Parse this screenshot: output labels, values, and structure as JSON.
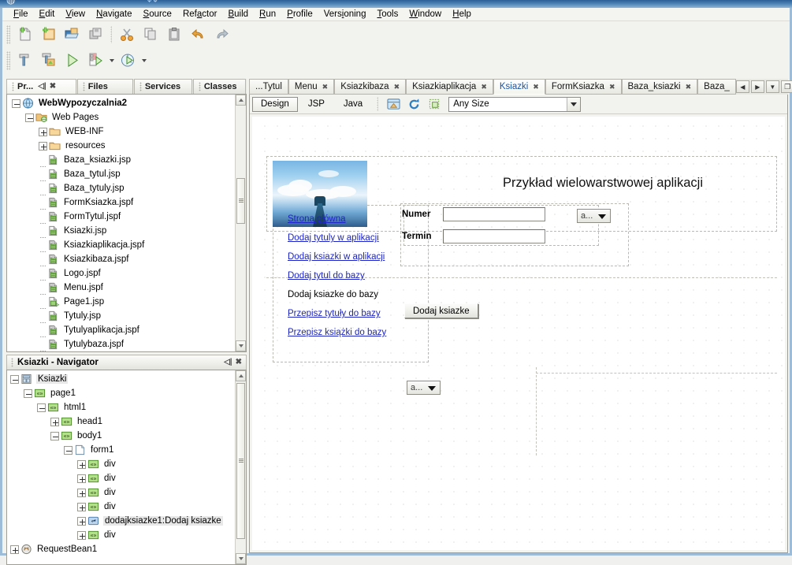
{
  "menubar": {
    "items": [
      {
        "label": "File",
        "mn": "F"
      },
      {
        "label": "Edit",
        "mn": "E"
      },
      {
        "label": "View",
        "mn": "V"
      },
      {
        "label": "Navigate",
        "mn": "N"
      },
      {
        "label": "Source",
        "mn": "S"
      },
      {
        "label": "Refactor",
        "mn": "a"
      },
      {
        "label": "Build",
        "mn": "B"
      },
      {
        "label": "Run",
        "mn": "R"
      },
      {
        "label": "Profile",
        "mn": "P"
      },
      {
        "label": "Versioning",
        "mn": "i"
      },
      {
        "label": "Tools",
        "mn": "T"
      },
      {
        "label": "Window",
        "mn": "W"
      },
      {
        "label": "Help",
        "mn": "H"
      }
    ]
  },
  "toolbar": {
    "row1": [
      {
        "name": "new-file-icon",
        "title": "New File"
      },
      {
        "name": "new-project-icon",
        "title": "New Project"
      },
      {
        "name": "open-project-icon",
        "title": "Open Project"
      },
      {
        "name": "save-all-icon",
        "title": "Save All"
      },
      {
        "name": "cut-icon",
        "title": "Cut"
      },
      {
        "name": "copy-icon",
        "title": "Copy"
      },
      {
        "name": "paste-icon",
        "title": "Paste"
      },
      {
        "name": "undo-icon",
        "title": "Undo"
      },
      {
        "name": "redo-icon",
        "title": "Redo"
      }
    ],
    "row2": [
      {
        "name": "build-icon",
        "title": "Build Main Project"
      },
      {
        "name": "clean-build-icon",
        "title": "Clean and Build Main Project"
      },
      {
        "name": "run-icon",
        "title": "Run Main Project"
      },
      {
        "name": "debug-icon",
        "title": "Debug Main Project"
      },
      {
        "name": "profile-icon",
        "title": "Profile Main Project"
      }
    ]
  },
  "left": {
    "tabs": [
      {
        "label": "Pr...",
        "active": true
      },
      {
        "label": "Files",
        "active": false
      },
      {
        "label": "Services",
        "active": false
      },
      {
        "label": "Classes",
        "active": false
      }
    ],
    "tab_icons": {
      "minimize": "minimize-icon",
      "close": "close-icon"
    },
    "tree": [
      {
        "label": "WebWypozyczalnia2",
        "depth": 0,
        "kind": "project",
        "handle": "minus",
        "bold": true
      },
      {
        "label": "Web Pages",
        "depth": 1,
        "kind": "webpages",
        "handle": "minus",
        "bold": false
      },
      {
        "label": "WEB-INF",
        "depth": 2,
        "kind": "folder",
        "handle": "plus",
        "bold": false
      },
      {
        "label": "resources",
        "depth": 2,
        "kind": "folder",
        "handle": "plus",
        "bold": false
      },
      {
        "label": "Baza_ksiazki.jsp",
        "depth": 2,
        "kind": "jsp",
        "handle": "none",
        "bold": false
      },
      {
        "label": "Baza_tytul.jsp",
        "depth": 2,
        "kind": "jsp",
        "handle": "none",
        "bold": false
      },
      {
        "label": "Baza_tytuly.jsp",
        "depth": 2,
        "kind": "jsp",
        "handle": "none",
        "bold": false
      },
      {
        "label": "FormKsiazka.jspf",
        "depth": 2,
        "kind": "jspf",
        "handle": "none",
        "bold": false
      },
      {
        "label": "FormTytul.jspf",
        "depth": 2,
        "kind": "jspf",
        "handle": "none",
        "bold": false
      },
      {
        "label": "Ksiazki.jsp",
        "depth": 2,
        "kind": "jsp",
        "handle": "none",
        "bold": false
      },
      {
        "label": "Ksiazkiaplikacja.jspf",
        "depth": 2,
        "kind": "jspf",
        "handle": "none",
        "bold": false
      },
      {
        "label": "Ksiazkibaza.jspf",
        "depth": 2,
        "kind": "jspf",
        "handle": "none",
        "bold": false
      },
      {
        "label": "Logo.jspf",
        "depth": 2,
        "kind": "jspf",
        "handle": "none",
        "bold": false
      },
      {
        "label": "Menu.jspf",
        "depth": 2,
        "kind": "jspf",
        "handle": "none",
        "bold": false
      },
      {
        "label": "Page1.jsp",
        "depth": 2,
        "kind": "jsp-main",
        "handle": "none",
        "bold": false
      },
      {
        "label": "Tytuly.jsp",
        "depth": 2,
        "kind": "jsp",
        "handle": "none",
        "bold": false
      },
      {
        "label": "Tytulyaplikacja.jspf",
        "depth": 2,
        "kind": "jspf",
        "handle": "none",
        "bold": false
      },
      {
        "label": "Tytulybaza.jspf",
        "depth": 2,
        "kind": "jspf",
        "handle": "none",
        "bold": false
      }
    ]
  },
  "navigator": {
    "title": "Ksiazki - Navigator",
    "icons": {
      "minimize": "minimize-icon",
      "close": "close-icon"
    },
    "tree": [
      {
        "label": "Ksiazki",
        "depth": 0,
        "kind": "page",
        "handle": "minus",
        "selected": true
      },
      {
        "label": "page1",
        "depth": 1,
        "kind": "tag",
        "handle": "minus",
        "selected": false
      },
      {
        "label": "html1",
        "depth": 2,
        "kind": "tag",
        "handle": "minus",
        "selected": false
      },
      {
        "label": "head1",
        "depth": 3,
        "kind": "tag",
        "handle": "plus",
        "selected": false
      },
      {
        "label": "body1",
        "depth": 3,
        "kind": "tag",
        "handle": "minus",
        "selected": false
      },
      {
        "label": "form1",
        "depth": 4,
        "kind": "form",
        "handle": "minus",
        "selected": false
      },
      {
        "label": "div",
        "depth": 5,
        "kind": "tag",
        "handle": "plus",
        "selected": false
      },
      {
        "label": "div",
        "depth": 5,
        "kind": "tag",
        "handle": "plus",
        "selected": false
      },
      {
        "label": "div",
        "depth": 5,
        "kind": "tag",
        "handle": "plus",
        "selected": false
      },
      {
        "label": "div",
        "depth": 5,
        "kind": "tag",
        "handle": "plus",
        "selected": false
      },
      {
        "label": "dodajksiazke1:Dodaj ksiazke",
        "depth": 5,
        "kind": "button",
        "handle": "plus",
        "selected": true
      },
      {
        "label": "div",
        "depth": 5,
        "kind": "tag",
        "handle": "plus",
        "selected": false
      },
      {
        "label": "RequestBean1",
        "depth": 0,
        "kind": "bean",
        "handle": "plus",
        "selected": false
      }
    ]
  },
  "editor": {
    "tabs": [
      {
        "label": "...Tytul",
        "closable": false,
        "active": false
      },
      {
        "label": "Menu",
        "closable": true,
        "active": false
      },
      {
        "label": "Ksiazkibaza",
        "closable": true,
        "active": false
      },
      {
        "label": "Ksiazkiaplikacja",
        "closable": true,
        "active": false
      },
      {
        "label": "Ksiazki",
        "closable": true,
        "active": true
      },
      {
        "label": "FormKsiazka",
        "closable": true,
        "active": false
      },
      {
        "label": "Baza_ksiazki",
        "closable": true,
        "active": false
      },
      {
        "label": "Baza_",
        "closable": false,
        "active": false
      }
    ],
    "close_glyph": "✖",
    "controls": [
      {
        "name": "scroll-tabs-left-button",
        "glyph": "◀"
      },
      {
        "name": "scroll-tabs-right-button",
        "glyph": "▶"
      },
      {
        "name": "tab-list-button",
        "glyph": "▼"
      },
      {
        "name": "maximize-editor-button",
        "glyph": "❐"
      }
    ],
    "view_buttons": [
      {
        "label": "Design",
        "active": true
      },
      {
        "label": "JSP",
        "active": false
      },
      {
        "label": "Java",
        "active": false
      }
    ],
    "design_icons": [
      {
        "name": "preview-in-browser-icon"
      },
      {
        "name": "refresh-icon"
      },
      {
        "name": "show-outline-icon"
      }
    ],
    "size_combo": {
      "value": "Any Size"
    }
  },
  "design": {
    "page_title": "Przykład wielowarstwowej aplikacji",
    "header_image_name": "header-photo-pier-clouds",
    "links": [
      {
        "label": "Strona główna",
        "is_link": true
      },
      {
        "label": "Dodaj tytuly w aplikacji",
        "is_link": true
      },
      {
        "label": "Dodaj ksiazki w aplikacji",
        "is_link": true
      },
      {
        "label": "Dodaj tytul do bazy",
        "is_link": true
      },
      {
        "label": "Dodaj ksiazke do bazy",
        "is_link": false
      },
      {
        "label": "Przepisz tytuły do bazy",
        "is_link": true
      },
      {
        "label": "Przepisz książki do bazy",
        "is_link": true
      }
    ],
    "form": {
      "fields": [
        {
          "label": "Numer",
          "value": ""
        },
        {
          "label": "Termin",
          "value": ""
        }
      ],
      "submit_label": "Dodaj ksiazke"
    },
    "dropdown_top": {
      "value": "a..."
    },
    "dropdown_bottom": {
      "value": "a..."
    }
  },
  "colors": {
    "accent": "#1b55a8",
    "link": "#1c24c8",
    "titlebar": "#2c5f96",
    "panel_bg": "#f2f2ef"
  }
}
